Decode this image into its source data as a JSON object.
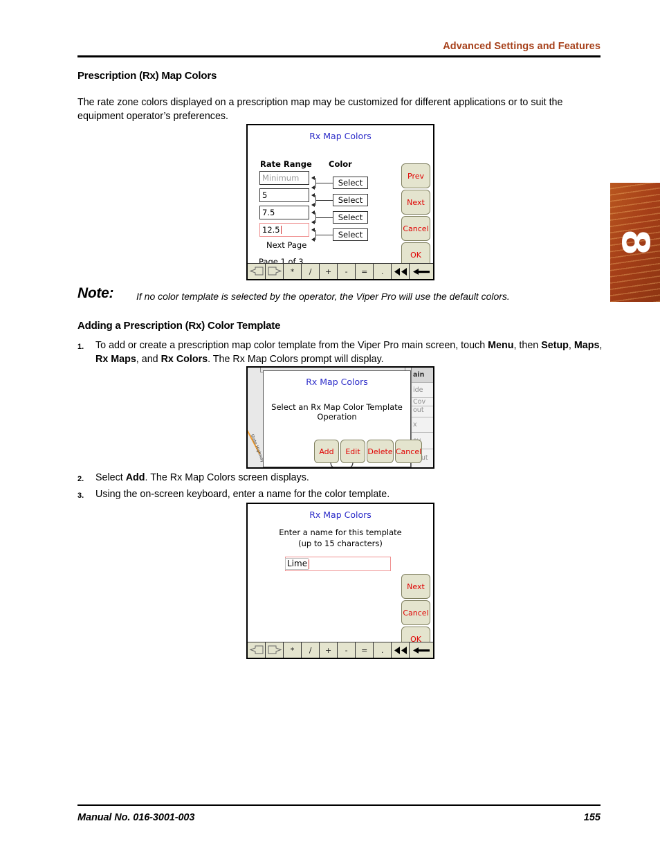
{
  "page": {
    "header_title": "Advanced Settings and Features",
    "footer_manual": "Manual No. 016-3001-003",
    "footer_page": "155",
    "chapter_tab_number": "8",
    "accent_color": "#A6401A",
    "dialog_title_color": "#2B2BC8",
    "device_button_text_color": "#E00000",
    "device_button_bg": "#E4E4CE"
  },
  "section1": {
    "heading": "Prescription (Rx) Map Colors",
    "paragraph": "The rate zone colors displayed on a prescription map may be customized for different applications or to suit the equipment operator’s preferences."
  },
  "note": {
    "label": "Note:",
    "text": "If no color template is selected by the operator, the Viper Pro will use the default colors."
  },
  "section2": {
    "heading": "Adding a Prescription (Rx) Color Template",
    "steps": [
      {
        "num": "1.",
        "html": "To add or create a prescription map color template from the Viper Pro main screen, touch <b>Menu</b>, then <b>Setup</b>, <b>Maps</b>, <b>Rx Maps</b>, and <b>Rx Colors</b>. The Rx Map Colors prompt will display."
      },
      {
        "num": "2.",
        "html": "Select <b>Add</b>. The Rx Map Colors screen displays."
      },
      {
        "num": "3.",
        "html": "Using the on-screen keyboard, enter a name for the color template."
      }
    ]
  },
  "dialog1": {
    "title": "Rx Map Colors",
    "col_header_rate": "Rate Range",
    "col_header_color": "Color",
    "rate_rows": [
      {
        "value": "Minimum",
        "is_placeholder": true,
        "is_active": false
      },
      {
        "value": "5",
        "is_placeholder": false,
        "is_active": false
      },
      {
        "value": "7.5",
        "is_placeholder": false,
        "is_active": false
      },
      {
        "value": "12.5",
        "is_placeholder": false,
        "is_active": true
      }
    ],
    "select_labels": [
      "Select",
      "Select",
      "Select",
      "Select"
    ],
    "next_page_label": "Next Page",
    "page_indicator": "Page 1 of 3",
    "side_buttons": [
      "Prev",
      "Next",
      "Cancel",
      "OK"
    ],
    "keys": [
      {
        "name": "shift-left-key",
        "glyph": "arrow-left-outline"
      },
      {
        "name": "shift-right-key",
        "glyph": "arrow-right-outline"
      },
      {
        "name": "asterisk-key",
        "glyph": "*"
      },
      {
        "name": "slash-key",
        "glyph": "/"
      },
      {
        "name": "plus-key",
        "glyph": "+"
      },
      {
        "name": "minus-key",
        "glyph": "-"
      },
      {
        "name": "equals-key",
        "glyph": "="
      },
      {
        "name": "period-key",
        "glyph": "."
      },
      {
        "name": "back-double-key",
        "glyph": "arrow-double-left"
      },
      {
        "name": "backspace-key",
        "glyph": "arrow-left-solid"
      }
    ]
  },
  "dialog2": {
    "title": "Rx Map Colors",
    "prompt_line1": "Select an Rx Map Color Template",
    "prompt_line2": "Operation",
    "buttons": [
      "Add",
      "Edit",
      "Delete",
      "Cancel"
    ],
    "map_road_label": "State Highway",
    "side_items": [
      "ain",
      "ide",
      "Cov",
      "out",
      "x",
      "ov",
      "bout"
    ]
  },
  "dialog3": {
    "title": "Rx Map Colors",
    "prompt_line1": "Enter a name for this template",
    "prompt_line2": "(up to 15 characters)",
    "input_value": "Lime",
    "side_buttons": [
      "Next",
      "Cancel",
      "OK"
    ],
    "keys": [
      {
        "name": "shift-left-key",
        "glyph": "arrow-left-outline"
      },
      {
        "name": "shift-right-key",
        "glyph": "arrow-right-outline"
      },
      {
        "name": "asterisk-key",
        "glyph": "*"
      },
      {
        "name": "slash-key",
        "glyph": "/"
      },
      {
        "name": "plus-key",
        "glyph": "+"
      },
      {
        "name": "minus-key",
        "glyph": "-"
      },
      {
        "name": "equals-key",
        "glyph": "="
      },
      {
        "name": "period-key",
        "glyph": "."
      },
      {
        "name": "back-double-key",
        "glyph": "arrow-double-left"
      },
      {
        "name": "backspace-key",
        "glyph": "arrow-left-solid"
      }
    ]
  }
}
